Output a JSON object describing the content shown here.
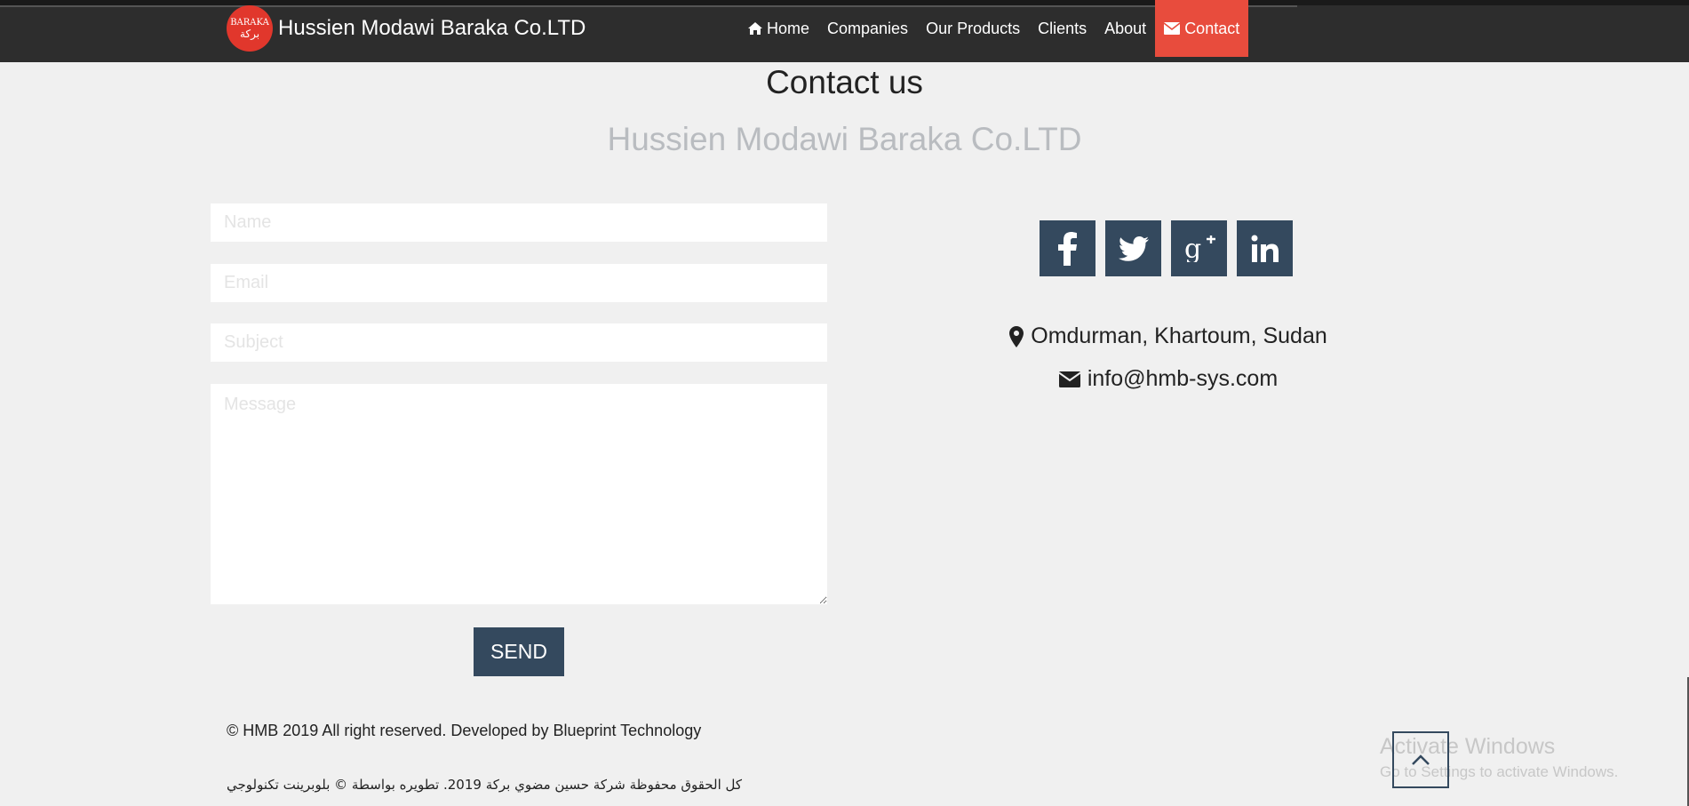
{
  "brand": {
    "logo_top": "BARAKA",
    "logo_bottom": "بركة",
    "name": "Hussien Modawi Baraka Co.LTD"
  },
  "nav": {
    "items": [
      {
        "label": "Home",
        "icon": "home-icon"
      },
      {
        "label": "Companies"
      },
      {
        "label": "Our Products"
      },
      {
        "label": "Clients"
      },
      {
        "label": "About"
      },
      {
        "label": "Contact",
        "icon": "envelope-icon",
        "active": true
      }
    ],
    "active_color": "#e84c3d"
  },
  "page": {
    "title": "Contact us",
    "subtitle": "Hussien Modawi Baraka Co.LTD"
  },
  "form": {
    "name_placeholder": "Name",
    "email_placeholder": "Email",
    "subject_placeholder": "Subject",
    "message_placeholder": "Message",
    "send_label": "SEND",
    "button_color": "#34495e"
  },
  "social": {
    "items": [
      "facebook-icon",
      "twitter-icon",
      "google-plus-icon",
      "linkedin-icon"
    ]
  },
  "contact": {
    "address": "Omdurman, Khartoum, Sudan",
    "email": "info@hmb-sys.com"
  },
  "footer": {
    "copyright": "© HMB 2019 All right reserved. Developed by Blueprint Technology",
    "copyright_ar": "كل الحقوق محفوظة شركة حسين مضوي بركة 2019. تطويره بواسطة © بلوبرينت تكنولوجي"
  },
  "watermark": {
    "line1": "Activate Windows",
    "line2": "Go to Settings to activate Windows."
  }
}
